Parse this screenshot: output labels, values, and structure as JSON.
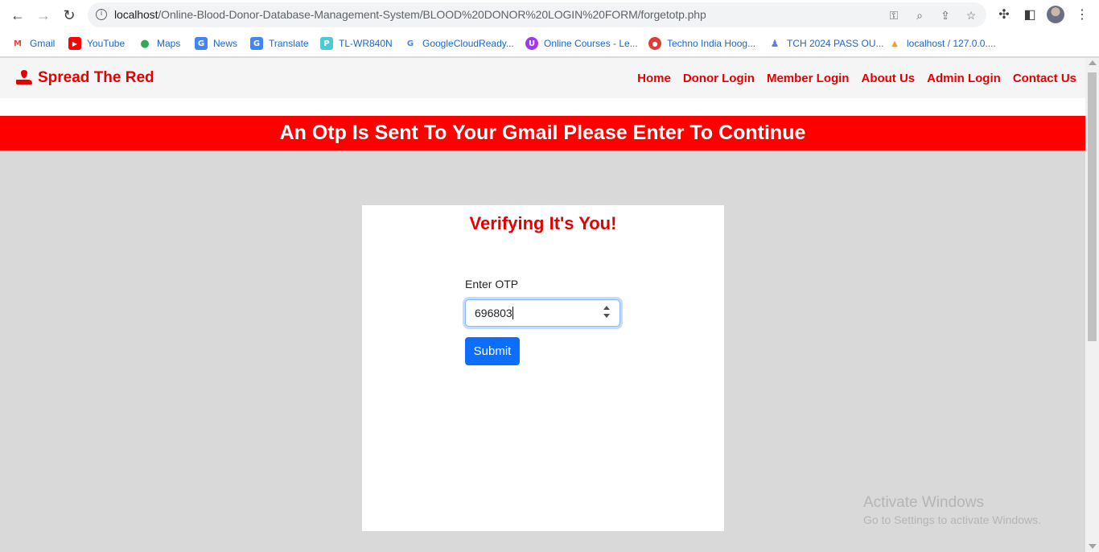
{
  "browser": {
    "url_host": "localhost",
    "url_path": "/Online-Blood-Donor-Database-Management-System/BLOOD%20DONOR%20LOGIN%20FORM/forgetotp.php",
    "bookmarks": [
      {
        "label": "Gmail",
        "icon": "gmail-icon",
        "color": "#ea4335",
        "glyph": "M"
      },
      {
        "label": "YouTube",
        "icon": "youtube-icon",
        "color": "#ff0000",
        "glyph": "▶"
      },
      {
        "label": "Maps",
        "icon": "maps-icon",
        "color": "#34a853",
        "glyph": "●"
      },
      {
        "label": "News",
        "icon": "news-icon",
        "color": "#4285f4",
        "glyph": "G"
      },
      {
        "label": "Translate",
        "icon": "translate-icon",
        "color": "#4285f4",
        "glyph": "G"
      },
      {
        "label": "TL-WR840N",
        "icon": "tplink-icon",
        "color": "#4acbd6",
        "glyph": "P"
      },
      {
        "label": "GoogleCloudReady...",
        "icon": "google-icon",
        "color": "#ffffff",
        "glyph": "G"
      },
      {
        "label": "Online Courses - Le...",
        "icon": "udemy-icon",
        "color": "#a435f0",
        "glyph": "U"
      },
      {
        "label": "Techno India Hoog...",
        "icon": "techno-india-icon",
        "color": "#e53935",
        "glyph": "●"
      },
      {
        "label": "TCH 2024 PASS OU...",
        "icon": "group-icon",
        "color": "#5b7ce6",
        "glyph": "♟"
      },
      {
        "label": "localhost / 127.0.0....",
        "icon": "phpmyadmin-icon",
        "color": "#f0a030",
        "glyph": "▲"
      }
    ]
  },
  "site": {
    "brand": "Spread The Red",
    "nav": [
      "Home",
      "Donor Login",
      "Member Login",
      "About Us",
      "Admin Login",
      "Contact Us"
    ],
    "accent_color": "#e60000"
  },
  "banner": {
    "text": "An Otp Is Sent To Your Gmail Please Enter To Continue"
  },
  "form": {
    "title": "Verifying It's You!",
    "otp_label": "Enter OTP",
    "otp_value": "696803",
    "submit_label": "Submit"
  },
  "watermark": {
    "title": "Activate Windows",
    "subtitle": "Go to Settings to activate Windows."
  }
}
